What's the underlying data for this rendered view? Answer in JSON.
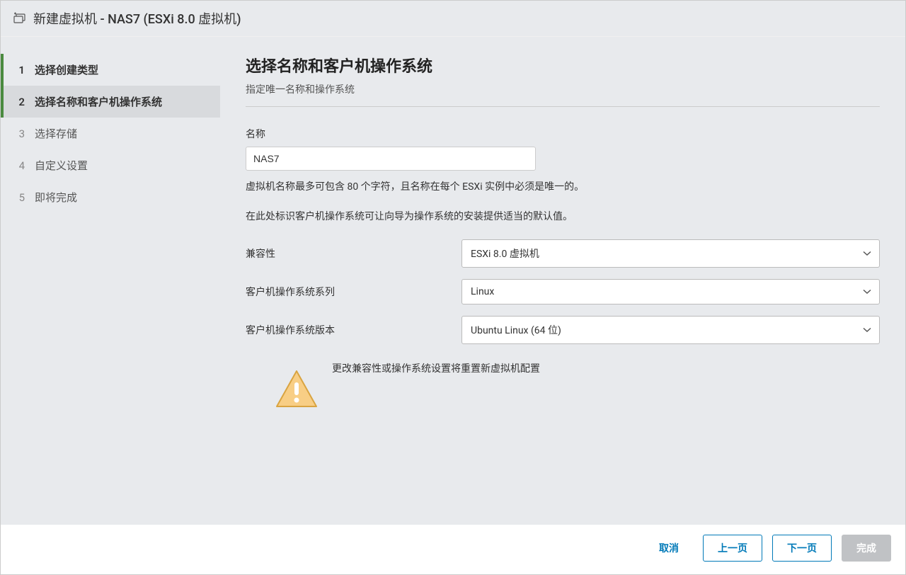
{
  "header": {
    "title": "新建虚拟机 - NAS7 (ESXi 8.0 虚拟机)"
  },
  "sidebar": {
    "steps": [
      {
        "num": "1",
        "label": "选择创建类型"
      },
      {
        "num": "2",
        "label": "选择名称和客户机操作系统"
      },
      {
        "num": "3",
        "label": "选择存储"
      },
      {
        "num": "4",
        "label": "自定义设置"
      },
      {
        "num": "5",
        "label": "即将完成"
      }
    ]
  },
  "content": {
    "title": "选择名称和客户机操作系统",
    "subtitle": "指定唯一名称和操作系统",
    "name_label": "名称",
    "name_value": "NAS7",
    "name_hint": "虚拟机名称最多可包含 80 个字符，且名称在每个 ESXi 实例中必须是唯一的。",
    "os_hint": "在此处标识客户机操作系统可让向导为操作系统的安装提供适当的默认值。",
    "rows": {
      "compat_label": "兼容性",
      "compat_value": "ESXi 8.0 虚拟机",
      "family_label": "客户机操作系统系列",
      "family_value": "Linux",
      "version_label": "客户机操作系统版本",
      "version_value": "Ubuntu Linux (64 位)"
    },
    "warning_text": "更改兼容性或操作系统设置将重置新虚拟机配置"
  },
  "footer": {
    "cancel": "取消",
    "back": "上一页",
    "next": "下一页",
    "finish": "完成"
  }
}
